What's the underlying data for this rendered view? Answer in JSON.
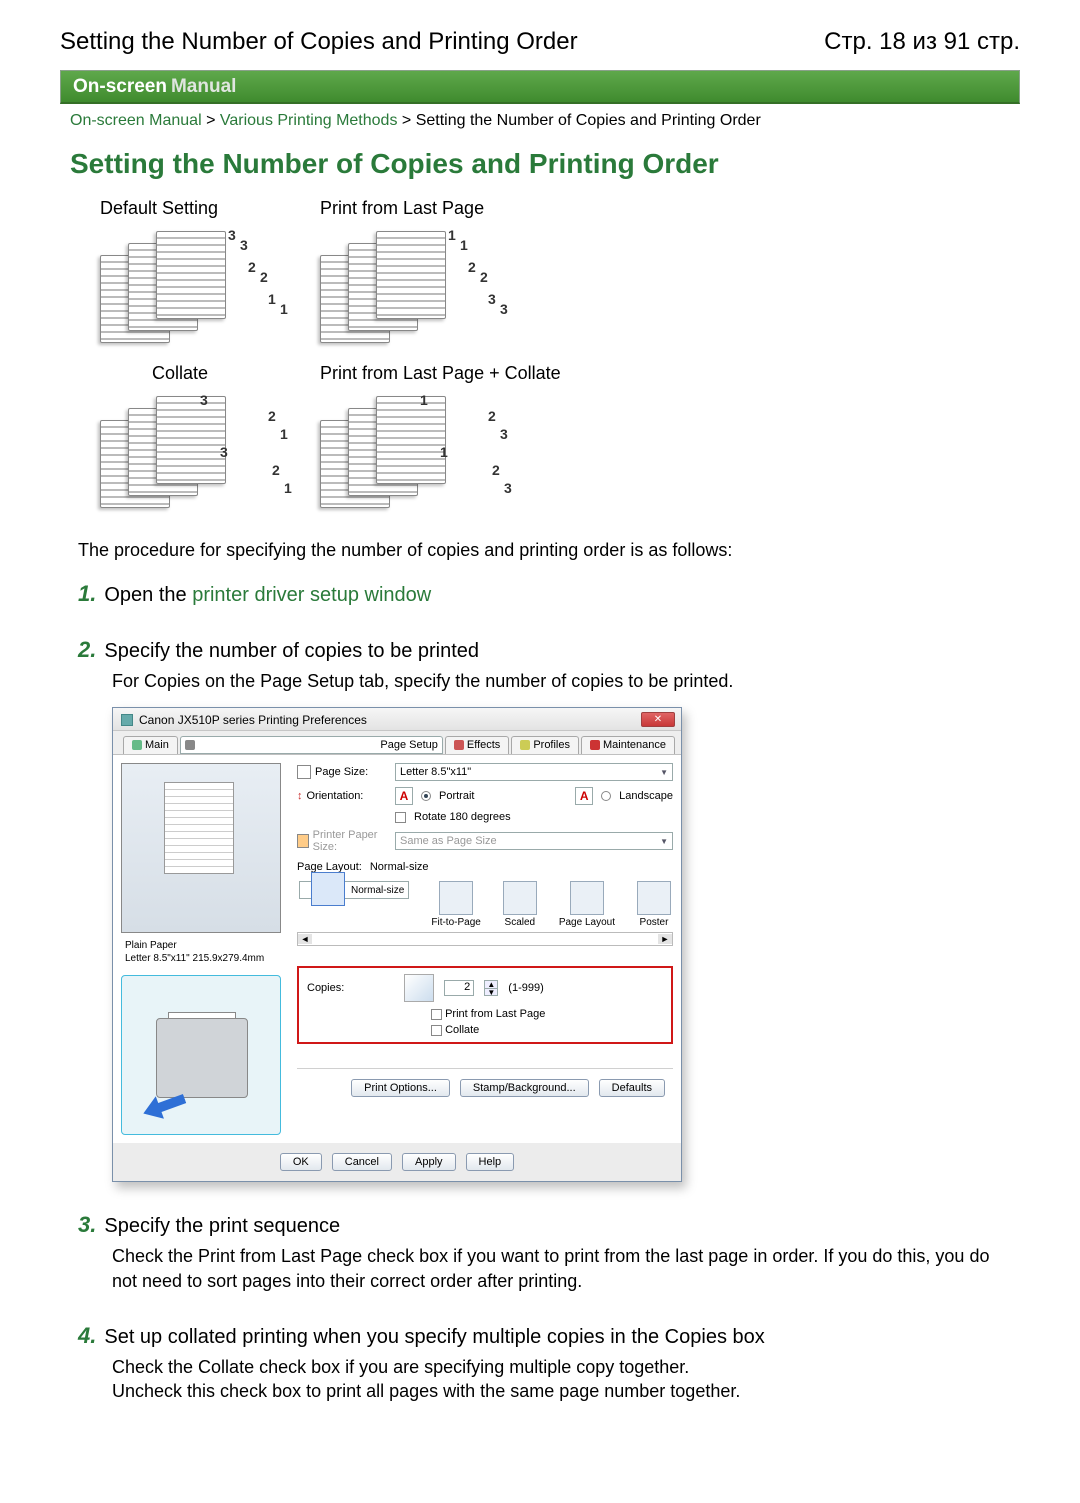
{
  "header": {
    "title": "Setting the Number of Copies and Printing Order",
    "page_indicator": "Стр. 18 из 91 стр."
  },
  "manual_bar": {
    "left": "On-screen",
    "right": "Manual"
  },
  "breadcrumbs": {
    "a": "On-screen Manual",
    "b": "Various Printing Methods",
    "c": "Setting the Number of Copies and Printing Order",
    "sep": ">"
  },
  "h1": "Setting the Number of Copies and Printing Order",
  "illus_labels": {
    "default": "Default Setting",
    "last": "Print from Last Page",
    "collate": "Collate",
    "last_collate": "Print from Last Page + Collate"
  },
  "intro": "The procedure for specifying the number of copies and printing order is as follows:",
  "steps": {
    "s1": {
      "num": "1.",
      "pre": "Open the ",
      "link": "printer driver setup window"
    },
    "s2": {
      "num": "2.",
      "title": "Specify the number of copies to be printed",
      "body": "For Copies on the Page Setup tab, specify the number of copies to be printed."
    },
    "s3": {
      "num": "3.",
      "title": "Specify the print sequence",
      "body": "Check the Print from Last Page check box if you want to print from the last page in order. If you do this, you do not need to sort pages into their correct order after printing."
    },
    "s4": {
      "num": "4.",
      "title": "Set up collated printing when you specify multiple copies in the Copies box",
      "body1": "Check the Collate check box if you are specifying multiple copy together.",
      "body2": "Uncheck this check box to print all pages with the same page number together."
    }
  },
  "dialog": {
    "title": "Canon JX510P series Printing Preferences",
    "tabs": {
      "main": "Main",
      "page_setup": "Page Setup",
      "effects": "Effects",
      "profiles": "Profiles",
      "maint": "Maintenance"
    },
    "labels": {
      "page_size": "Page Size:",
      "orientation": "Orientation:",
      "portrait": "Portrait",
      "landscape": "Landscape",
      "rotate": "Rotate 180 degrees",
      "printer_paper": "Printer Paper Size:",
      "page_layout_lbl": "Page Layout:",
      "page_layout_val": "Normal-size",
      "copies": "Copies:",
      "range": "(1-999)",
      "from_last": "Print from Last Page",
      "collate": "Collate"
    },
    "page_size_value": "Letter 8.5\"x11\"",
    "printer_paper_value": "Same as Page Size",
    "copies_value": "2",
    "media": {
      "line1": "Plain Paper",
      "line2": "Letter 8.5\"x11\" 215.9x279.4mm"
    },
    "layouts": {
      "a": "Normal-size",
      "b": "Fit-to-Page",
      "c": "Scaled",
      "d": "Page Layout",
      "e": "Poster"
    },
    "buttons": {
      "print_options": "Print Options...",
      "stamp": "Stamp/Background...",
      "defaults": "Defaults",
      "ok": "OK",
      "cancel": "Cancel",
      "apply": "Apply",
      "help": "Help"
    }
  },
  "illus_nums": {
    "default": [
      "3",
      "3",
      "2",
      "2",
      "1",
      "1"
    ],
    "last": [
      "1",
      "1",
      "2",
      "2",
      "3",
      "3"
    ],
    "collate": [
      "3",
      "2",
      "1",
      "3",
      "2",
      "1"
    ],
    "last_collate": [
      "1",
      "2",
      "3",
      "1",
      "2",
      "3"
    ]
  }
}
